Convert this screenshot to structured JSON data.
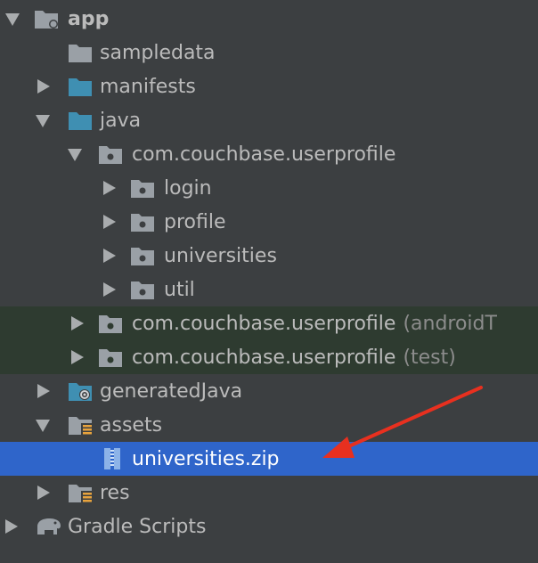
{
  "tree": {
    "app": "app",
    "sampledata": "sampledata",
    "manifests": "manifests",
    "java": "java",
    "pkg_main": "com.couchbase.userprofile",
    "login": "login",
    "profile": "profile",
    "universities": "universities",
    "util": "util",
    "pkg_android": "com.couchbase.userprofile",
    "pkg_android_suffix": "(androidT",
    "pkg_test": "com.couchbase.userprofile",
    "pkg_test_suffix": "(test)",
    "generatedJava": "generatedJava",
    "assets": "assets",
    "universities_zip": "universities.zip",
    "res": "res",
    "gradle_scripts": "Gradle Scripts"
  },
  "colors": {
    "background": "#3c3f41",
    "selection": "#2f65ca",
    "tinted_row": "#2e3b30",
    "folder_gray": "#9aa0a6",
    "folder_blue": "#3f8fb2",
    "annotation_red": "#e8301f"
  }
}
